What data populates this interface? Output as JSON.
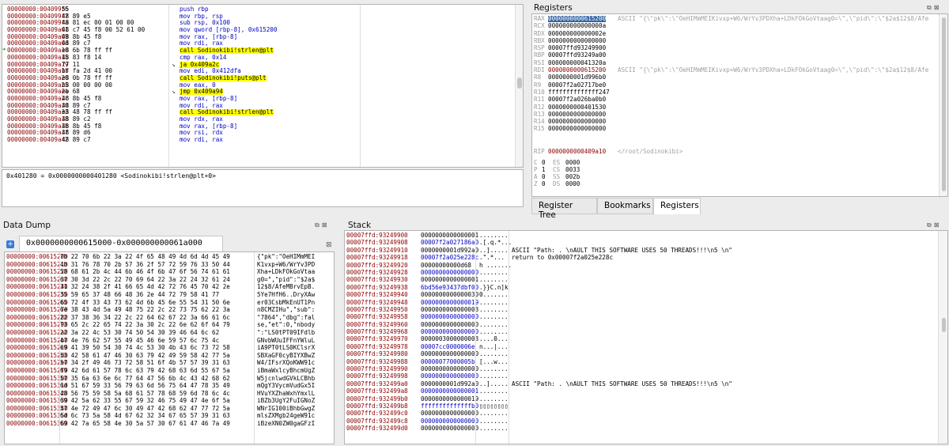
{
  "disasm": {
    "rows": [
      {
        "addr": "00000000:004099f6",
        "bytes": "55",
        "instr": "push rbp",
        "kind": "n"
      },
      {
        "addr": "00000000:004099f7",
        "bytes": "48 89 e5",
        "instr": "mov rbp, rsp",
        "kind": "n"
      },
      {
        "addr": "00000000:004099fa",
        "bytes": "48 81 ec 00 01 00 00",
        "instr": "sub rsp, 0x100",
        "kind": "n"
      },
      {
        "addr": "00000000:00409a01",
        "bytes": "48 c7 45 f8 00 52 61 00",
        "instr": "mov qword [rbp-8], 0x615200",
        "kind": "n"
      },
      {
        "addr": "00000000:00409a09",
        "bytes": "48 8b 45 f8",
        "instr": "mov rax, [rbp-8]",
        "kind": "n"
      },
      {
        "addr": "00000000:00409a0d",
        "bytes": "48 89 c7",
        "instr": "mov rdi, rax",
        "kind": "n"
      },
      {
        "addr": "00000000:00409a10",
        "bytes": "e8 6b 78 ff ff",
        "instr": "call Sodinokibi!strlen@plt",
        "kind": "call",
        "current": true
      },
      {
        "addr": "00000000:00409a15",
        "bytes": "48 83 f8 14",
        "instr": "cmp rax, 0x14",
        "kind": "n"
      },
      {
        "addr": "00000000:00409a19",
        "bytes": "77 11",
        "instr": "ja 0x409a2c",
        "kind": "ja"
      },
      {
        "addr": "00000000:00409a1b",
        "bytes": "bf fa 2d 41 00",
        "instr": "mov edi, 0x412dfa",
        "kind": "n"
      },
      {
        "addr": "00000000:00409a20",
        "bytes": "e8 0b 78 ff ff",
        "instr": "call Sodinokibi!puts@plt",
        "kind": "call"
      },
      {
        "addr": "00000000:00409a25",
        "bytes": "b8 00 00 00 00",
        "instr": "mov eax, 0",
        "kind": "n"
      },
      {
        "addr": "00000000:00409a2a",
        "bytes": "eb 68",
        "instr": "jmp 0x409a94",
        "kind": "jmp"
      },
      {
        "addr": "00000000:00409a2c",
        "bytes": "48 8b 45 f8",
        "instr": "mov rax, [rbp-8]",
        "kind": "n"
      },
      {
        "addr": "00000000:00409a30",
        "bytes": "48 89 c7",
        "instr": "mov rdi, rax",
        "kind": "n"
      },
      {
        "addr": "00000000:00409a33",
        "bytes": "e8 48 78 ff ff",
        "instr": "call Sodinokibi!strlen@plt",
        "kind": "call"
      },
      {
        "addr": "00000000:00409a38",
        "bytes": "48 89 c2",
        "instr": "mov rdx, rax",
        "kind": "n"
      },
      {
        "addr": "00000000:00409a3b",
        "bytes": "48 8b 45 f8",
        "instr": "mov rax, [rbp-8]",
        "kind": "n"
      },
      {
        "addr": "00000000:00409a3f",
        "bytes": "48 89 d6",
        "instr": "mov rsi, rdx",
        "kind": "n"
      },
      {
        "addr": "00000000:00409a42",
        "bytes": "48 89 c7",
        "instr": "mov rdi, rax",
        "kind": "n"
      }
    ]
  },
  "info_line": "0x401280 = 0x0000000000401280 <Sodinokibi!strlen@plt+0>",
  "registers": {
    "title": "Registers",
    "rows": [
      {
        "name": "RAX",
        "value": "0000000000615200",
        "note": "ASCII \"{\\\"pk\\\":\\\"OeHIMmMEIKivxp+W6/WrYv3PDXha+LDkFOkGoVtaag0=\\\",\\\"pid\\\":\\\"$2a$12$8/Afe",
        "sel": true
      },
      {
        "name": "RCX",
        "value": "000000000000000a",
        "note": ""
      },
      {
        "name": "RDX",
        "value": "000000000000002e",
        "note": ""
      },
      {
        "name": "RBX",
        "value": "0000000000000000",
        "note": ""
      },
      {
        "name": "RSP",
        "value": "00007ffd93249900",
        "note": ""
      },
      {
        "name": "RBP",
        "value": "00007ffd93249a00",
        "note": ""
      },
      {
        "name": "RSI",
        "value": "000000000041320a",
        "note": ""
      },
      {
        "name": "RDI",
        "value": "0000000000615200",
        "note": "ASCII \"{\\\"pk\\\":\\\"OeHIMmMEIKivxp+W6/WrYv3PDXha+LDkFOkGoVtaag0=\\\",\\\"pid\\\":\\\"$2a$12$8/Afe",
        "red": true
      },
      {
        "name": "R8",
        "value": "0000000001d996b0",
        "note": ""
      },
      {
        "name": "R9",
        "value": "00007f2a02717be0",
        "note": ""
      },
      {
        "name": "R10",
        "value": "ffffffffffffff247",
        "note": ""
      },
      {
        "name": "R11",
        "value": "00007f2a026ba0b0",
        "note": ""
      },
      {
        "name": "R12",
        "value": "0000000000401530",
        "note": ""
      },
      {
        "name": "R13",
        "value": "0000000000000000",
        "note": ""
      },
      {
        "name": "R14",
        "value": "0000000000000000",
        "note": ""
      },
      {
        "name": "R15",
        "value": "0000000000000000",
        "note": ""
      }
    ],
    "rip": {
      "name": "RIP",
      "value": "0000000000409a10",
      "note": "</root/Sodinokibi>"
    },
    "flags": [
      {
        "f": "C",
        "v": "0",
        "seg": "ES",
        "sv": "0000"
      },
      {
        "f": "P",
        "v": "1",
        "seg": "CS",
        "sv": "0033"
      },
      {
        "f": "A",
        "v": "0",
        "seg": "SS",
        "sv": "002b"
      },
      {
        "f": "Z",
        "v": "0",
        "seg": "DS",
        "sv": "0000"
      }
    ],
    "tabs": [
      "Register Tree",
      "Bookmarks",
      "Registers"
    ]
  },
  "dump": {
    "title": "Data Dump",
    "tab": "0x0000000000615000-0x000000000061a000",
    "rows": [
      {
        "addr": "00000000:00615200",
        "hex": "7b 22 70 6b 22 3a 22 4f 65 48 49 4d 6d 4d 45 49",
        "ascii": "{\"pk\":\"OeHIMmMEI"
      },
      {
        "addr": "00000000:00615210",
        "hex": "4b 31 76 78 70 2b 57 36 2f 57 72 59 76 33 50 44",
        "ascii": "K1vxp+W6/WrYv3PD"
      },
      {
        "addr": "00000000:00615220",
        "hex": "58 68 61 2b 4c 44 6b 46 4f 6b 47 6f 56 74 61 61",
        "ascii": "Xha+LDkFOkGoVtaa"
      },
      {
        "addr": "00000000:00615230",
        "hex": "67 30 3d 22 2c 22 70 69 64 22 3a 22 24 32 61 24",
        "ascii": "g0=\",\"pid\":\"$2a$"
      },
      {
        "addr": "00000000:00615240",
        "hex": "31 32 24 38 2f 41 66 65 4d 42 72 76 45 70 42 2e",
        "ascii": "12$8/AfeMBrvEpB."
      },
      {
        "addr": "00000000:00615250",
        "hex": "35 59 65 37 48 66 48 36 2e 44 72 79 58 41 77 ",
        "ascii": "5Ye7HfH6..DryXAw"
      },
      {
        "addr": "00000000:00615260",
        "hex": "65 72 4f 33 43 73 62 4d 6b 45 6e 55 54 31 50 6e",
        "ascii": "er03CsbMkEnUT1Pn"
      },
      {
        "addr": "00000000:00615270",
        "hex": "6e 38 43 4d 5a 49 48 75 22 2c 22 73 75 62 22 3a",
        "ascii": "n8CMZIHu\",\"sub\":"
      },
      {
        "addr": "00000000:00615280",
        "hex": "22 37 38 36 34 22 2c 22 64 62 67 22 3a 66 61 6c",
        "ascii": "\"7864\",\"dbg\":fal"
      },
      {
        "addr": "00000000:00615290",
        "hex": "73 65 2c 22 65 74 22 3a 30 2c 22 6e 62 6f 64 79",
        "ascii": "se,\"et\":0,\"nbody"
      },
      {
        "addr": "00000000:006152a0",
        "hex": "22 3a 22 4c 53 30 74 50 54 30 39 46 64 6c 62 ",
        "ascii": "\":\"LS0tPT09IFdlb"
      },
      {
        "addr": "00000000:006152b0",
        "hex": "47 4e 76 62 57 55 49 45 46 6e 59 57 6c 75 4c ",
        "ascii": "GNvbWUuIFFnYWluL"
      },
      {
        "addr": "00000000:006152c0",
        "hex": "69 41 39 50 54 30 74 4c 53 30 4b 43 6c 73 72 58",
        "ascii": "iA9PT0tLS0KClsrX"
      },
      {
        "addr": "00000000:006152d0",
        "hex": "53 42 58 61 47 46 30 63 79 42 49 59 58 42 77 5a",
        "ascii": "SBXaGF0cyBIYXBwZ"
      },
      {
        "addr": "00000000:006152e0",
        "hex": "57 34 2f 49 46 73 72 58 51 6f 4b 57 57 39 31 63",
        "ascii": "W4/IFsrXQoKWW91c"
      },
      {
        "addr": "00000000:006152f0",
        "hex": "69 42 6d 61 57 78 6c 63 79 42 68 63 6d 55 67 5a",
        "ascii": "iBmaWxlcyBhcmUgZ"
      },
      {
        "addr": "00000000:00615300",
        "hex": "57 35 6a 63 6e 6c 77 64 47 56 6b 4c 43 42 68 62",
        "ascii": "W5jcnlwdGVkLCBhb"
      },
      {
        "addr": "00000000:00615310",
        "hex": "6d 51 67 59 33 56 79 63 6d 56 75 64 47 78 35 49",
        "ascii": "mQgY3VycmVudGx5I"
      },
      {
        "addr": "00000000:00615320",
        "hex": "48 56 75 59 58 5a 68 61 57 78 68 59 6d 78 6c 4c",
        "ascii": "HVuYXZhaWxhYmxlL"
      },
      {
        "addr": "00000000:00615330",
        "hex": "69 42 5a 62 33 55 67 59 32 46 75 49 47 4e 6f 5a",
        "ascii": "iBZb3UgY2FuIGNoZ"
      },
      {
        "addr": "00000000:00615340",
        "hex": "57 4e 72 49 47 6c 30 49 47 42 68 62 47 77 72 5a",
        "ascii": "WNrIG100iBhbGwgZ"
      },
      {
        "addr": "00000000:00615350",
        "hex": "6d 6c 73 5a 58 4d 67 62 32 34 67 65 57 39 31 63",
        "ascii": "mlsZXMgb24geW91c"
      },
      {
        "addr": "00000000:00615360",
        "hex": "69 42 7a 65 58 4e 30 5a 57 30 67 61 47 46 7a 49",
        "ascii": "iBzeXN0ZW0gaGFzI"
      }
    ]
  },
  "stack": {
    "title": "Stack",
    "rows": [
      {
        "addr": "00007ffd:93249900",
        "val": "0000000000000001",
        "ascii": "........",
        "note": "",
        "blue": false
      },
      {
        "addr": "00007ffd:93249908",
        "val": "00007f2a027186a0",
        "ascii": ".[.q.*...",
        "note": "",
        "blue": true
      },
      {
        "addr": "00007ffd:93249910",
        "val": "0000000001d992a0",
        "ascii": "..].....",
        "note": "ASCII \"Path: . \\nAULT THIS SOFTWARE USES 50 THREADS!!!\\n5 \\n\"",
        "blue": false
      },
      {
        "addr": "00007ffd:93249918",
        "val": "00007f2a025e228c",
        "ascii": ".\".*...",
        "note": "return to 0x00007f2a025e228c",
        "blue": true
      },
      {
        "addr": "00007ffd:93249920",
        "val": "00000000000d68",
        "ascii": "h .......",
        "note": "",
        "blue": false
      },
      {
        "addr": "00007ffd:93249928",
        "val": "0000000000000000",
        "ascii": "........",
        "note": "",
        "blue": true
      },
      {
        "addr": "00007ffd:93249930",
        "val": "0000000000000001",
        "ascii": "........",
        "note": "",
        "blue": false
      },
      {
        "addr": "00007ffd:93249938",
        "val": "6bd56e93437dbf00",
        "ascii": ".}}C.n]k",
        "note": "",
        "blue": true
      },
      {
        "addr": "00007ffd:93249940",
        "val": "0000000000000030",
        "ascii": "0.......",
        "note": "",
        "blue": false
      },
      {
        "addr": "00007ffd:93249948",
        "val": "0000000000000019",
        "ascii": "........",
        "note": "",
        "blue": true
      },
      {
        "addr": "00007ffd:93249950",
        "val": "0000000000000003",
        "ascii": "........",
        "note": "",
        "blue": false
      },
      {
        "addr": "00007ffd:93249958",
        "val": "0000000000000000",
        "ascii": "........",
        "note": "",
        "blue": true
      },
      {
        "addr": "00007ffd:93249960",
        "val": "0000000000000000",
        "ascii": "........",
        "note": "",
        "blue": false
      },
      {
        "addr": "00007ffd:93249968",
        "val": "0000000000000000",
        "ascii": "........",
        "note": "",
        "blue": true
      },
      {
        "addr": "00007ffd:93249970",
        "val": "0000003000000003",
        "ascii": "....0...",
        "note": "",
        "blue": false
      },
      {
        "addr": "00007ffd:93249978",
        "val": "00007cc0000006e",
        "ascii": "n...|...",
        "note": "",
        "blue": true
      },
      {
        "addr": "00007ffd:93249980",
        "val": "0000000000000000",
        "ascii": "........",
        "note": "",
        "blue": false
      },
      {
        "addr": "00007ffd:93249988",
        "val": "00000077000005b",
        "ascii": "[...w...",
        "note": "",
        "blue": true
      },
      {
        "addr": "00007ffd:93249990",
        "val": "0000000000000000",
        "ascii": "........",
        "note": "",
        "blue": false
      },
      {
        "addr": "00007ffd:93249998",
        "val": "0000000000000000",
        "ascii": "........",
        "note": "",
        "blue": true
      },
      {
        "addr": "00007ffd:932499a0",
        "val": "0000000001d992a0",
        "ascii": "..].....",
        "note": "ASCII \"Path: . \\nAULT THIS SOFTWARE USES 50 THREADS!!!\\n5 \\n\"",
        "blue": false
      },
      {
        "addr": "00007ffd:932499a8",
        "val": "0000000000000001",
        "ascii": "........",
        "note": "",
        "blue": true
      },
      {
        "addr": "00007ffd:932499b0",
        "val": "0000000000000019",
        "ascii": "........",
        "note": "",
        "blue": false
      },
      {
        "addr": "00007ffd:932499b8",
        "val": "ffffffffffffffb0",
        "ascii": "▯▯▯▯▯▯▯▯",
        "note": "",
        "blue": true
      },
      {
        "addr": "00007ffd:932499c0",
        "val": "0000000000000000",
        "ascii": "........",
        "note": "",
        "blue": false
      },
      {
        "addr": "00007ffd:932499c8",
        "val": "0000000000000000",
        "ascii": "........",
        "note": "",
        "blue": true
      },
      {
        "addr": "00007ffd:932499d0",
        "val": "0000000000000000",
        "ascii": "........",
        "note": "",
        "blue": false
      }
    ]
  },
  "colors": {
    "address": "#8b0000",
    "keyword": "#0000c0",
    "highlight": "#ffff00",
    "selection": "#3465a4",
    "arrow": "#2e8b2e"
  }
}
